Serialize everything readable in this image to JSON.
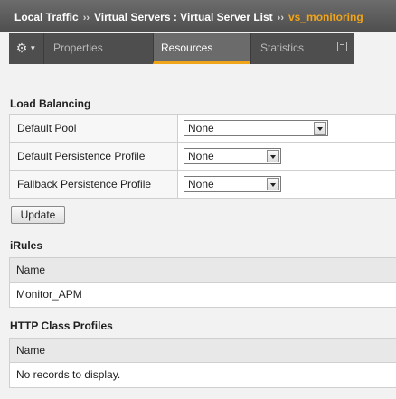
{
  "breadcrumb": {
    "items": [
      "Local Traffic",
      "Virtual Servers : Virtual Server List"
    ],
    "separator": "››",
    "current": "vs_monitoring"
  },
  "tabs": {
    "gear_icon": "gear-icon",
    "properties": "Properties",
    "resources": "Resources",
    "statistics": "Statistics"
  },
  "load_balancing": {
    "title": "Load Balancing",
    "rows": [
      {
        "label": "Default Pool",
        "value": "None"
      },
      {
        "label": "Default Persistence Profile",
        "value": "None"
      },
      {
        "label": "Fallback Persistence Profile",
        "value": "None"
      }
    ],
    "update_label": "Update"
  },
  "irules": {
    "title": "iRules",
    "header": "Name",
    "rows": [
      "Monitor_APM"
    ]
  },
  "http_class": {
    "title": "HTTP Class Profiles",
    "header": "Name",
    "empty_message": "No records to display."
  },
  "colors": {
    "accent": "#f0a419",
    "tab_bg": "#4e4e4e",
    "active_tab_bg": "#6b6b6b"
  }
}
